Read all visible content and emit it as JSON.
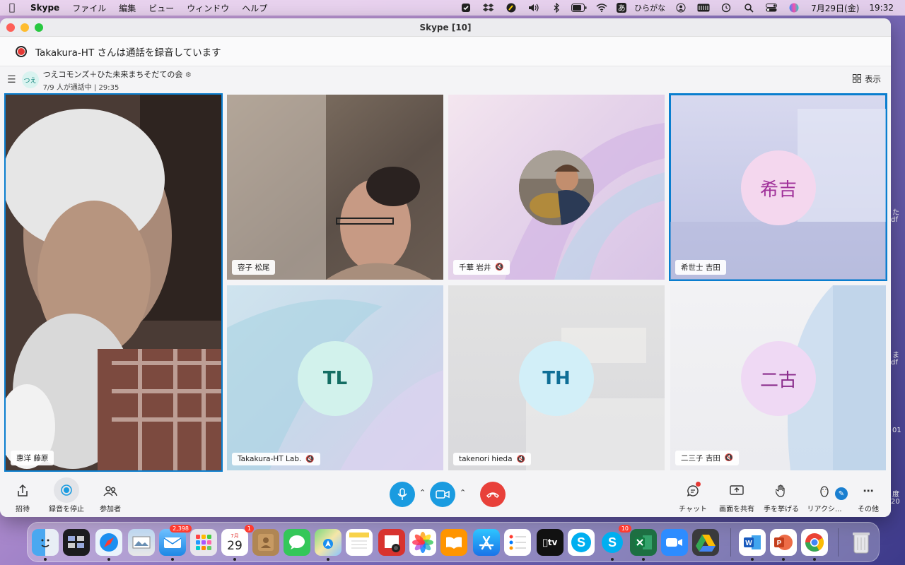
{
  "menubar": {
    "app_name": "Skype",
    "menus": [
      "ファイル",
      "編集",
      "ビュー",
      "ウィンドウ",
      "ヘルプ"
    ],
    "input_source": "あ",
    "input_label": "ひらがな",
    "date": "7月29日(金)",
    "time": "19:32"
  },
  "window": {
    "title": "Skype [10]"
  },
  "recording_banner": {
    "text": "Takakura-HT さんは通話を録音しています"
  },
  "conversation": {
    "avatar_text": "つえ",
    "group_name": "つえコモンズ＋ひた未来まちそだての会",
    "status": "7/9 人が通話中 | 29:35",
    "view_label": "表示"
  },
  "participants": [
    {
      "name": "惠洋 藤原",
      "muted": false,
      "active": true,
      "type": "video"
    },
    {
      "name": "容子 松尾",
      "muted": false,
      "active": false,
      "type": "video"
    },
    {
      "name": "千華 岩井",
      "muted": true,
      "active": false,
      "type": "photo"
    },
    {
      "name": "希世士 吉田",
      "muted": false,
      "active": true,
      "type": "initials",
      "initials": "希吉"
    },
    {
      "name": "Takakura-HT Lab.",
      "muted": true,
      "active": false,
      "type": "initials",
      "initials": "TL"
    },
    {
      "name": "takenori hieda",
      "muted": true,
      "active": false,
      "type": "initials",
      "initials": "TH"
    },
    {
      "name": "二三子 吉田",
      "muted": true,
      "active": false,
      "type": "initials",
      "initials": "二古"
    }
  ],
  "controls": {
    "invite": "招待",
    "stop_recording": "録音を停止",
    "participants": "参加者",
    "chat": "チャット",
    "share_screen": "画面を共有",
    "raise_hand": "手を挙げる",
    "reactions": "リアクシ...",
    "more": "その他"
  },
  "dock": {
    "mail_badge": "2,398",
    "calendar_month": "7月",
    "calendar_day": "29",
    "calendar_badge": "1",
    "skype_badge": "10",
    "appletv_label": "tv"
  },
  "desktop_fragments": [
    "た",
    "df",
    "ま",
    "df",
    "01",
    "度",
    "20"
  ],
  "colors": {
    "accent": "#0a7ecf",
    "end_call": "#e8403a",
    "mic": "#1a9be0"
  }
}
